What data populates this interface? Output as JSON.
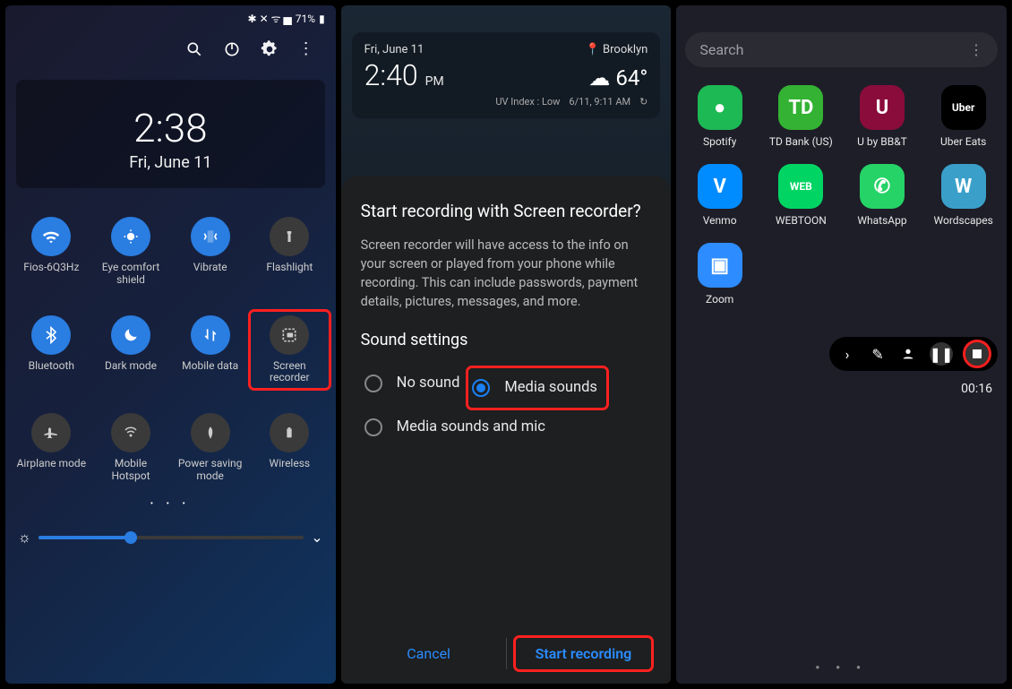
{
  "status": {
    "icons": "✱ ✕ ᯤ ▅ ",
    "battery": "71%"
  },
  "toolbar": {
    "items": [
      "search",
      "power",
      "settings",
      "more"
    ]
  },
  "clock": {
    "time": "2:38",
    "date": "Fri, June 11"
  },
  "qs": {
    "tiles": [
      {
        "label": "Fios-6Q3Hz",
        "icon": "wifi",
        "active": true
      },
      {
        "label": "Eye comfort shield",
        "icon": "eye",
        "active": true
      },
      {
        "label": "Vibrate",
        "icon": "vibrate",
        "active": true
      },
      {
        "label": "Flashlight",
        "icon": "flashlight",
        "active": false
      },
      {
        "label": "Bluetooth",
        "icon": "bluetooth",
        "active": true
      },
      {
        "label": "Dark mode",
        "icon": "moon",
        "active": true
      },
      {
        "label": "Mobile data",
        "icon": "data",
        "active": true
      },
      {
        "label": "Screen recorder",
        "icon": "record",
        "active": false,
        "highlighted": true
      },
      {
        "label": "Airplane mode",
        "icon": "plane",
        "active": false
      },
      {
        "label": "Mobile Hotspot",
        "icon": "hotspot",
        "active": false
      },
      {
        "label": "Power saving mode",
        "icon": "power-save",
        "active": false
      },
      {
        "label": "Wireless",
        "icon": "battery",
        "active": false
      }
    ]
  },
  "home_widget": {
    "date": "Fri, June 11",
    "location": "Brooklyn",
    "time": "2:40",
    "ampm": "PM",
    "temp": "64°",
    "uv": "UV Index : Low",
    "updated": "6/11, 9:11 AM"
  },
  "dialog": {
    "title": "Start recording with Screen recorder?",
    "body": "Screen recorder will have access to the info on your screen or played from your phone while recording. This can include passwords, payment details, pictures, messages, and more.",
    "section": "Sound settings",
    "options": [
      {
        "label": "No sound",
        "selected": false
      },
      {
        "label": "Media sounds",
        "selected": true,
        "highlighted": true
      },
      {
        "label": "Media sounds and mic",
        "selected": false
      }
    ],
    "cancel": "Cancel",
    "confirm": "Start recording"
  },
  "drawer": {
    "search_placeholder": "Search",
    "apps": [
      {
        "label": "Spotify",
        "bg": "#1db954",
        "glyph": "●"
      },
      {
        "label": "TD Bank (US)",
        "bg": "#34b233",
        "glyph": "TD"
      },
      {
        "label": "U by BB&T",
        "bg": "#8a0c3a",
        "glyph": "U"
      },
      {
        "label": "Uber Eats",
        "bg": "#000",
        "glyph": "Uber"
      },
      {
        "label": "Venmo",
        "bg": "#008cff",
        "glyph": "V"
      },
      {
        "label": "WEBTOON",
        "bg": "#00d564",
        "glyph": "WEB"
      },
      {
        "label": "WhatsApp",
        "bg": "#25d366",
        "glyph": "✆"
      },
      {
        "label": "Wordscapes",
        "bg": "#3aa0c9",
        "glyph": "W"
      },
      {
        "label": "Zoom",
        "bg": "#2d8cff",
        "glyph": "▣"
      }
    ]
  },
  "recorder": {
    "timer": "00:16"
  }
}
